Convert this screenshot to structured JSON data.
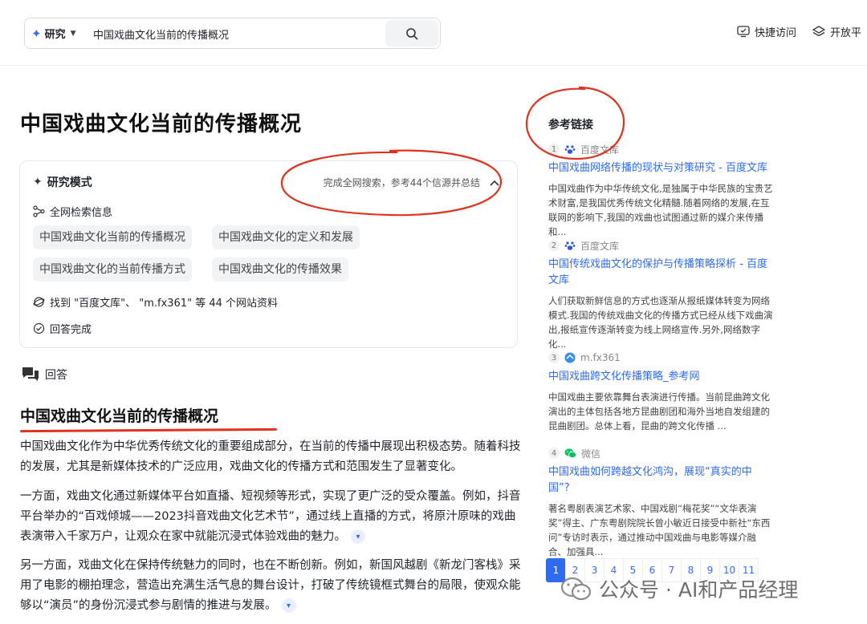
{
  "search": {
    "mode_label": "研究",
    "query": "中国戏曲文化当前的传播概况"
  },
  "top_links": [
    {
      "label": "快捷访问",
      "icon": "quick-access-icon"
    },
    {
      "label": "开放平",
      "icon": "layers-icon"
    }
  ],
  "page_title": "中国戏曲文化当前的传播概况",
  "research": {
    "mode_title": "研究模式",
    "status": "完成全网搜索，参考44个信源并总结",
    "web_search_title": "全网检索信息",
    "chips": [
      "中国戏曲文化当前的传播概况",
      "中国戏曲文化的定义和发展",
      "中国戏曲文化的当前传播方式",
      "中国戏曲文化的传播效果"
    ],
    "found_text": "找到 \"百度文库\"、 \"m.fx361\" 等 44 个网站资料",
    "done_text": "回答完成"
  },
  "answer": {
    "label": "回答",
    "heading": "中国戏曲文化当前的传播概况",
    "paragraphs": [
      "中国戏曲文化作为中华优秀传统文化的重要组成部分，在当前的传播中展现出积极态势。随着科技的发展，尤其是新媒体技术的广泛应用，戏曲文化的传播方式和范围发生了显著变化。",
      "一方面，戏曲文化通过新媒体平台如直播、短视频等形式，实现了更广泛的受众覆盖。例如，抖音平台举办的“百戏倾城——2023抖音戏曲文化艺术节”，通过线上直播的方式，将原汁原味的戏曲表演带入千家万户，让观众在家中就能沉浸式体验戏曲的魅力。",
      "另一方面，戏曲文化在保持传统魅力的同时，也在不断创新。例如，新国风越剧《新龙门客栈》采用了电影的棚拍理念，营造出充满生活气息的舞台设计，打破了传统镜框式舞台的局限，使观众能够以“演员”的身份沉浸式参与剧情的推进与发展。"
    ]
  },
  "references": {
    "title": "参考链接",
    "items": [
      {
        "num": "1",
        "source": "百度文库",
        "icon": "baidu-paw-icon",
        "title": "中国戏曲网络传播的现状与对策研究 - 百度文库",
        "snippet": "中国戏曲作为中华传统文化,是独属于中华民族的宝贵艺术财富,是我国优秀传统文化精髓.随着网络的发展,在互联网的影响下,我国的戏曲也试图通过新的媒介来传播和..."
      },
      {
        "num": "2",
        "source": "百度文库",
        "icon": "baidu-paw-icon",
        "title": "中国传统戏曲文化的保护与传播策略探析 - 百度文库",
        "snippet": "人们获取新鲜信息的方式也逐渐从报纸媒体转变为网络模式.我国的传统戏曲文化的传播方式已经从线下戏曲演出,报纸宣传逐渐转变为线上网络宣传.另外,网络数字化..."
      },
      {
        "num": "3",
        "source": "m.fx361",
        "icon": "fx361-icon",
        "title": "中国戏曲跨文化传播策略_参考网",
        "snippet": "中国戏曲主要依靠舞台表演进行传播。当前昆曲跨文化演出的主体包括各地方昆曲剧团和海外当地自发组建的昆曲剧团。总体上看，昆曲的跨文化传播 ..."
      },
      {
        "num": "4",
        "source": "微信",
        "icon": "wechat-icon",
        "title": "中国戏曲如何跨越文化鸿沟，展现“真实的中国”?",
        "snippet": "著名粤剧表演艺术家、中国戏剧“梅花奖”“文华表演奖”得主、广东粤剧院院长曾小敏近日接受中新社“东西问”专访时表示，通过推动中国戏曲与电影等媒介融合、加强具..."
      }
    ]
  },
  "pagination": {
    "pages": [
      "1",
      "2",
      "3",
      "4",
      "5",
      "6",
      "7",
      "8",
      "9",
      "10",
      "11"
    ],
    "current": "1"
  },
  "watermark": "公众号 · AI和产品经理",
  "colors": {
    "accent": "#2f6bf0",
    "annotation_red": "#e0321f"
  }
}
